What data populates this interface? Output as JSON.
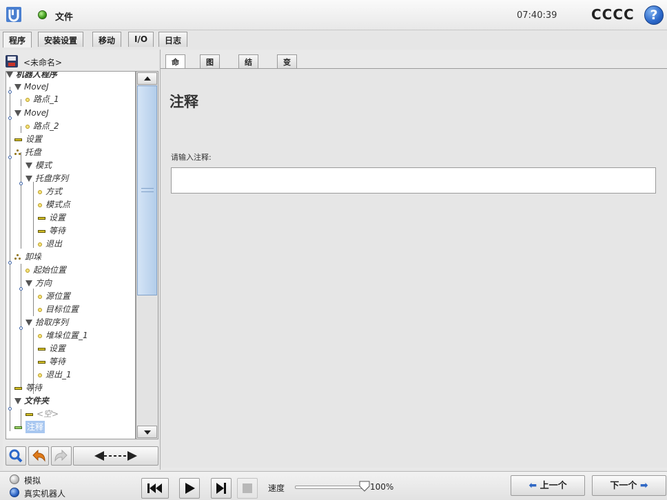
{
  "window": {
    "title": "文件",
    "clock": "07:40:39",
    "robot_name": "CCCC",
    "help_glyph": "?"
  },
  "main_tabs": [
    "程序",
    "安装设置",
    "移动",
    "I/O",
    "日志"
  ],
  "left": {
    "filename": "<未命名>",
    "tree": [
      {
        "label": "机器人程序",
        "icon": "triangle-icon"
      },
      {
        "label": "MoveJ",
        "icon": "triangle-icon"
      },
      {
        "label": "路点_1",
        "icon": "waypoint-icon"
      },
      {
        "label": "MoveJ",
        "icon": "triangle-icon"
      },
      {
        "label": "路点_2",
        "icon": "waypoint-icon"
      },
      {
        "label": "设置",
        "icon": "set-icon"
      },
      {
        "label": "托盘",
        "icon": "pallet-icon"
      },
      {
        "label": "模式",
        "icon": "triangle-icon"
      },
      {
        "label": "托盘序列",
        "icon": "triangle-icon"
      },
      {
        "label": "方式",
        "icon": "waypoint-icon"
      },
      {
        "label": "模式点",
        "icon": "waypoint-icon"
      },
      {
        "label": "设置",
        "icon": "set-icon"
      },
      {
        "label": "等待",
        "icon": "wait-icon"
      },
      {
        "label": "退出",
        "icon": "waypoint-icon"
      },
      {
        "label": "卸垛",
        "icon": "pallet-icon"
      },
      {
        "label": "起始位置",
        "icon": "waypoint-icon"
      },
      {
        "label": "方向",
        "icon": "triangle-icon"
      },
      {
        "label": "源位置",
        "icon": "waypoint-icon"
      },
      {
        "label": "目标位置",
        "icon": "waypoint-icon"
      },
      {
        "label": "拾取序列",
        "icon": "triangle-icon"
      },
      {
        "label": "堆垛位置_1",
        "icon": "waypoint-icon"
      },
      {
        "label": "设置",
        "icon": "set-icon"
      },
      {
        "label": "等待",
        "icon": "wait-icon"
      },
      {
        "label": "退出_1",
        "icon": "waypoint-icon"
      },
      {
        "label": "等待",
        "icon": "wait-icon"
      },
      {
        "label": "文件夹",
        "icon": "folder-icon"
      },
      {
        "label": "<空>",
        "icon": "empty-icon"
      },
      {
        "label": "注释",
        "icon": "comment-icon"
      }
    ]
  },
  "sub_tabs": [
    "命令",
    "图形",
    "结构",
    "变量"
  ],
  "content": {
    "heading": "注释",
    "prompt": "请输入注释:",
    "input_value": ""
  },
  "bottom": {
    "mode_sim": "模拟",
    "mode_real": "真实机器人",
    "speed_label": "速度",
    "speed_value": "100%",
    "speed_fraction": 1.0,
    "prev": "上一个",
    "next": "下一个"
  },
  "colors": {
    "accent_blue": "#2e67c4",
    "selection": "#a8c7f0",
    "ok_green": "#3c9a1a"
  }
}
